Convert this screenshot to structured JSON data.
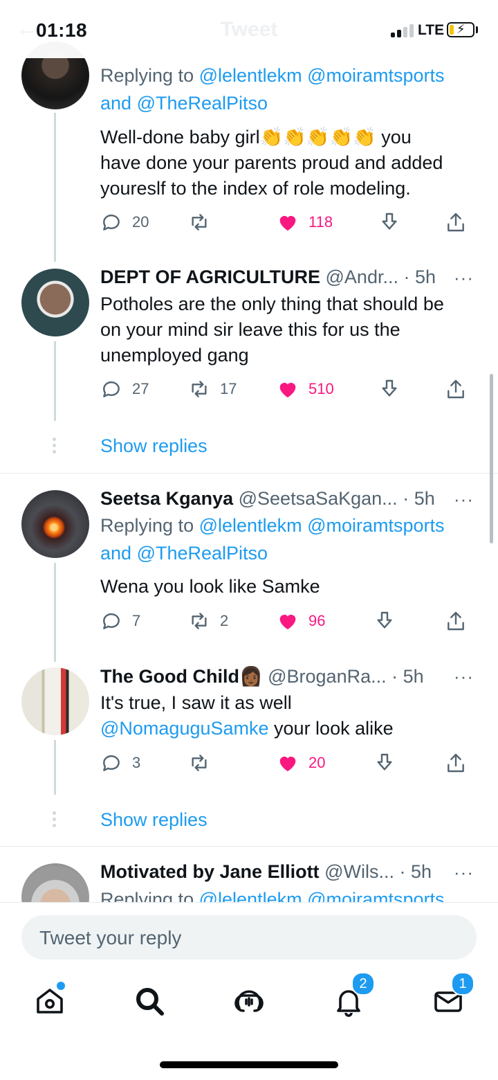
{
  "status_bar": {
    "time": "01:18",
    "network": "LTE"
  },
  "header": {
    "title": "Tweet"
  },
  "tweets": [
    {
      "reply_prefix": "Replying to",
      "reply_to": [
        "@lelentlekm",
        "@moiramtsports",
        "@TheRealPitso"
      ],
      "reply_and": "and",
      "text_lines": [
        "Well-done baby girl👏👏👏👏👏 you",
        "have done your parents proud and added",
        "youreslf to the index of role modeling."
      ],
      "replies": "20",
      "retweets": "",
      "likes": "118"
    },
    {
      "name": "DEPT OF AGRICULTURE",
      "handle": "@Andr...",
      "time": "· 5h",
      "text_lines": [
        "Potholes are the only thing that should be",
        "on your mind sir leave this for us the",
        "unemployed gang"
      ],
      "replies": "27",
      "retweets": "17",
      "likes": "510"
    },
    {
      "name": "Seetsa Kganya",
      "handle": "@SeetsaSaKgan...",
      "time": "· 5h",
      "reply_prefix": "Replying to",
      "reply_to": [
        "@lelentlekm",
        "@moiramtsports",
        "@TheRealPitso"
      ],
      "reply_and": "and",
      "text_lines": [
        "Wena you look like Samke"
      ],
      "replies": "7",
      "retweets": "2",
      "likes": "96"
    },
    {
      "name": "The Good Child👩🏾",
      "handle": "@BroganRa...",
      "time": "· 5h",
      "text_lines": [
        "It's true, I saw it as well"
      ],
      "text_mention": "@NomaguguSamke",
      "text_after_mention": " your look alike",
      "replies": "3",
      "retweets": "",
      "likes": "20"
    },
    {
      "name": "Motivated by Jane Elliott",
      "handle": "@Wils...",
      "time": "· 5h",
      "reply_prefix": "Replying to",
      "reply_to": [
        "@lelentlekm",
        "@moiramtsports"
      ]
    }
  ],
  "show_replies_label": "Show replies",
  "more_label": "···",
  "reply_composer": {
    "placeholder": "Tweet your reply"
  },
  "tab_bar": {
    "notifications_badge": "2",
    "messages_badge": "1"
  },
  "colors": {
    "accent": "#1d9bf0",
    "like": "#f91880",
    "text": "#0f1419",
    "secondary": "#536471"
  }
}
